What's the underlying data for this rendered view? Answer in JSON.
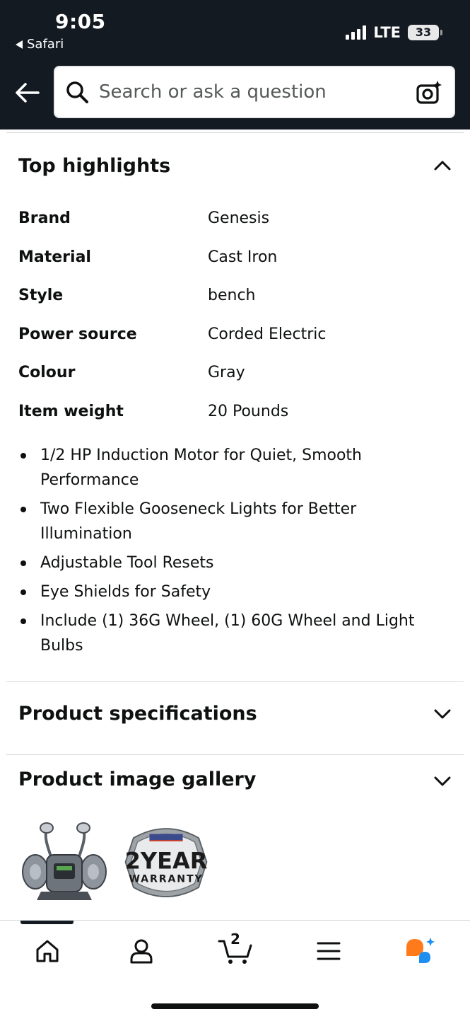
{
  "status_bar": {
    "time": "9:05",
    "back_app": "Safari",
    "network": "LTE",
    "battery": "33"
  },
  "search": {
    "placeholder": "Search or ask a question"
  },
  "highlights": {
    "title": "Top highlights",
    "rows": [
      {
        "key": "Brand",
        "value": "Genesis"
      },
      {
        "key": "Material",
        "value": "Cast Iron"
      },
      {
        "key": "Style",
        "value": "bench"
      },
      {
        "key": "Power source",
        "value": "Corded Electric"
      },
      {
        "key": "Colour",
        "value": "Gray"
      },
      {
        "key": "Item weight",
        "value": "20 Pounds"
      }
    ],
    "bullets": [
      "1/2 HP Induction Motor for Quiet, Smooth Performance",
      "Two Flexible Gooseneck Lights for Better Illumination",
      "Adjustable Tool Resets",
      "Eye Shields for Safety",
      "Include (1) 36G Wheel, (1) 60G Wheel and Light Bulbs"
    ]
  },
  "specifications": {
    "title": "Product specifications"
  },
  "gallery": {
    "title": "Product image gallery",
    "warranty_badge_text": "2 YEAR WARRANTY"
  },
  "bottom_nav": {
    "cart_count": "2",
    "items": [
      "home-icon",
      "account-icon",
      "cart-icon",
      "menu-icon",
      "rufus-assistant-icon"
    ]
  },
  "colors": {
    "header_bg": "#131a22",
    "text": "#0f1111",
    "divider": "#d5d9d9",
    "assistant_orange": "#ff7a1a",
    "assistant_blue": "#1f8ef1"
  }
}
